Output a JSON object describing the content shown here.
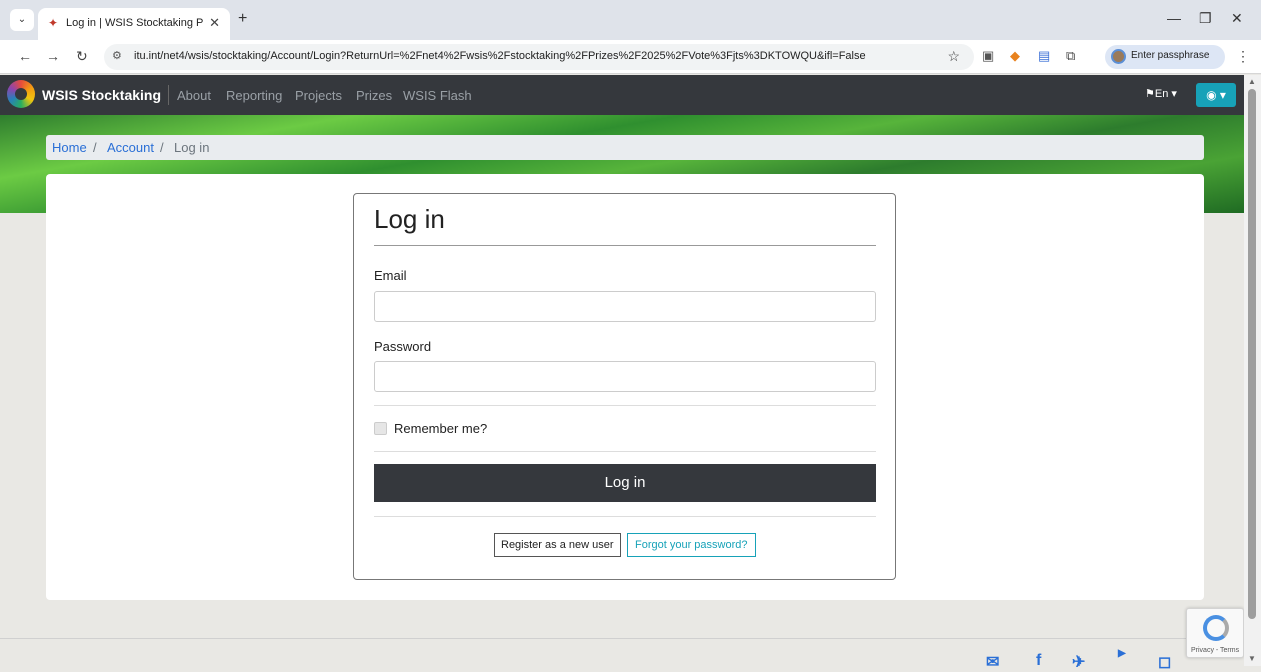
{
  "browser": {
    "tab_title": "Log in | WSIS Stocktaking Platfo",
    "url": "itu.int/net4/wsis/stocktaking/Account/Login?ReturnUrl=%2Fnet4%2Fwsis%2Fstocktaking%2FPrizes%2F2025%2FVote%3Fjts%3DKTOWQU&ifl=False",
    "passphrase_label": "Enter passphrase"
  },
  "navbar": {
    "brand": "WSIS Stocktaking",
    "links": [
      "About",
      "Reporting",
      "Projects",
      "Prizes",
      "WSIS Flash"
    ],
    "language": "En"
  },
  "breadcrumb": {
    "home": "Home",
    "account": "Account",
    "current": "Log in",
    "separator": "/"
  },
  "login": {
    "title": "Log in",
    "email_label": "Email",
    "email_value": "",
    "password_label": "Password",
    "password_value": "",
    "remember_label": "Remember me?",
    "remember_checked": false,
    "submit_label": "Log in",
    "register_label": "Register as a new user",
    "forgot_label": "Forgot your password?"
  },
  "recaptcha": {
    "footer_text": "Privacy - Terms"
  },
  "colors": {
    "navbar": "#35383d",
    "accent": "#17a2b8",
    "link": "#2a6fd6"
  }
}
